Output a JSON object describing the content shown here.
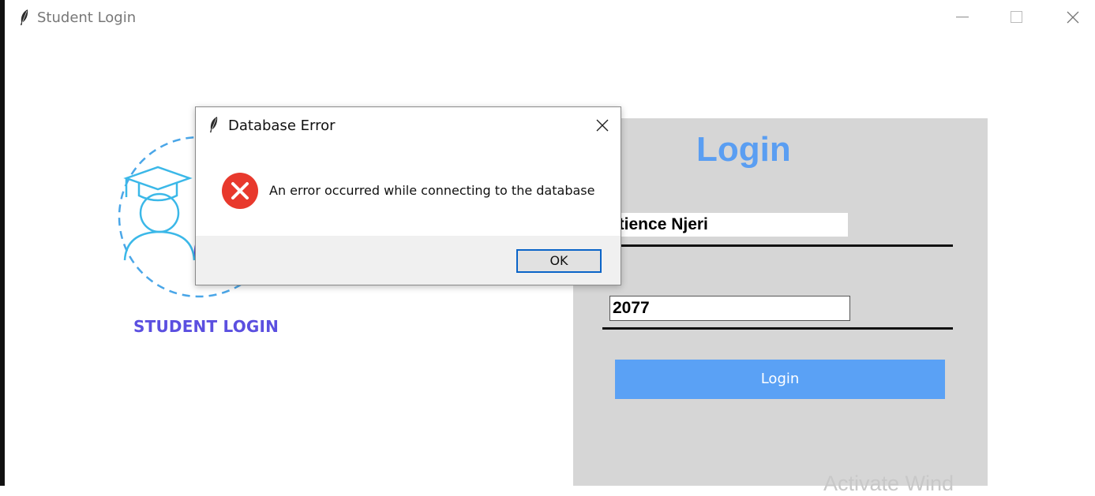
{
  "window": {
    "title": "Student Login"
  },
  "illustration": {
    "label": "STUDENT LOGIN"
  },
  "login_panel": {
    "title": "Login",
    "username_value": "atience Njeri",
    "password_value": "2077",
    "login_button": "Login",
    "watermark": "Activate Wind"
  },
  "dialog": {
    "title": "Database Error",
    "message": "An error occurred while connecting to the database",
    "ok_label": "OK",
    "icon": "error-icon"
  },
  "colors": {
    "accent": "#5a9ef2",
    "button": "#5aa1f5",
    "panel": "#d6d6d6",
    "error": "#e8392d",
    "label": "#5b4fe0"
  }
}
